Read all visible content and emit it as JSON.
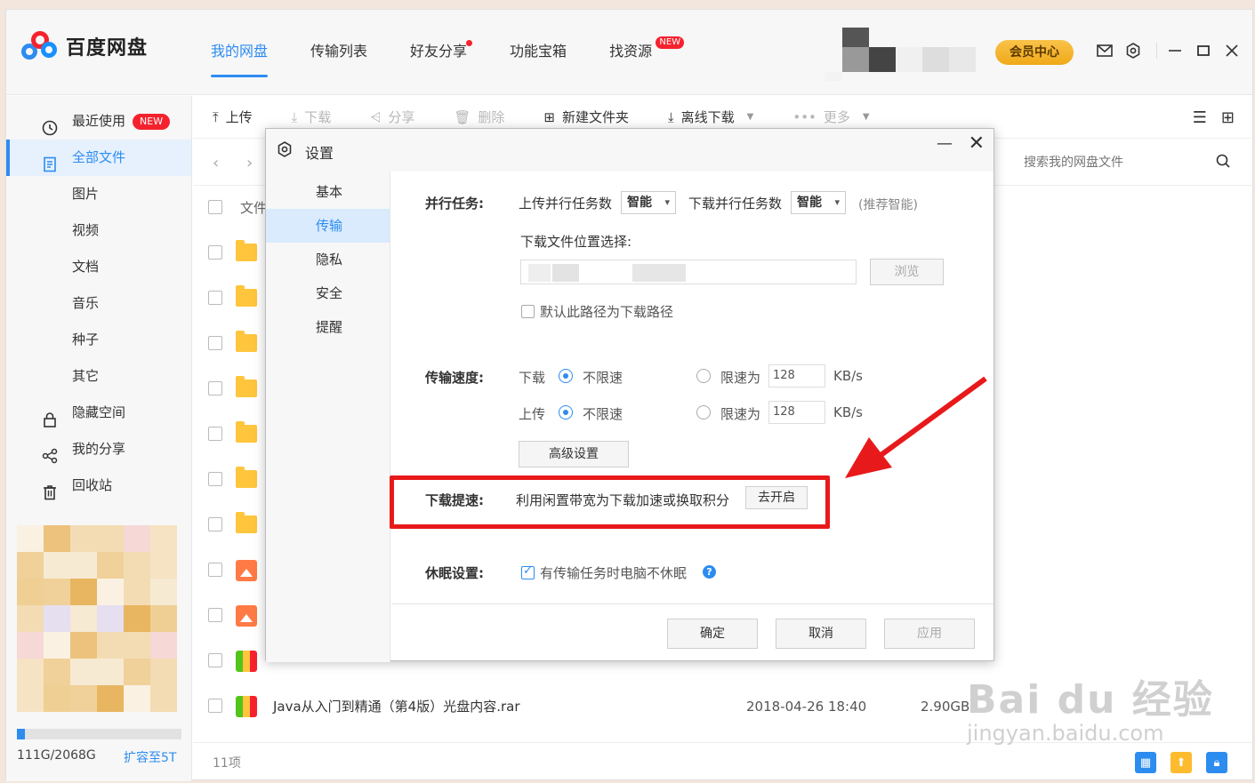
{
  "app": {
    "name": "百度网盘",
    "nav": [
      {
        "label": "我的网盘",
        "active": true
      },
      {
        "label": "传输列表"
      },
      {
        "label": "好友分享",
        "dot": true
      },
      {
        "label": "功能宝箱"
      },
      {
        "label": "找资源",
        "badge": "NEW"
      }
    ],
    "vip_label": "会员中心",
    "header_icons": [
      "mail-icon",
      "settings-icon",
      "minimize-icon",
      "maximize-icon",
      "close-icon"
    ]
  },
  "sidebar": {
    "items": [
      {
        "label": "最近使用",
        "icon": "clock-icon",
        "badge": "NEW"
      },
      {
        "label": "全部文件",
        "icon": "file-icon",
        "active": true
      },
      {
        "label": "图片"
      },
      {
        "label": "视频"
      },
      {
        "label": "文档"
      },
      {
        "label": "音乐"
      },
      {
        "label": "种子"
      },
      {
        "label": "其它"
      },
      {
        "label": "隐藏空间",
        "icon": "lock-icon"
      },
      {
        "label": "我的分享",
        "icon": "share-icon"
      },
      {
        "label": "回收站",
        "icon": "trash-icon"
      }
    ],
    "storage_text": "111G/2068G",
    "storage_percent": 5,
    "expand_label": "扩容至5T"
  },
  "toolbar": {
    "buttons": [
      {
        "label": "上传",
        "icon": "upload-icon"
      },
      {
        "label": "下载",
        "icon": "download-icon",
        "disabled": true
      },
      {
        "label": "分享",
        "icon": "share-icon",
        "disabled": true
      },
      {
        "label": "删除",
        "icon": "trash-icon",
        "disabled": true
      },
      {
        "label": "新建文件夹",
        "icon": "new-folder-icon"
      },
      {
        "label": "离线下载",
        "icon": "offline-download-icon",
        "dropdown": true
      },
      {
        "label": "更多",
        "icon": "more-icon",
        "disabled": true,
        "dropdown": true
      }
    ]
  },
  "search": {
    "placeholder": "搜索我的网盘文件"
  },
  "list": {
    "header_name": "文件",
    "rows": [
      {
        "type": "folder"
      },
      {
        "type": "folder"
      },
      {
        "type": "folder"
      },
      {
        "type": "folder"
      },
      {
        "type": "folder"
      },
      {
        "type": "folder"
      },
      {
        "type": "folder"
      },
      {
        "type": "image"
      },
      {
        "type": "image"
      },
      {
        "type": "rar"
      },
      {
        "type": "rar",
        "name": "Java从入门到精通（第4版）光盘内容.rar",
        "date": "2018-04-26 18:40",
        "size": "2.90GB"
      }
    ],
    "count": "11项"
  },
  "dialog": {
    "title": "设置",
    "nav": [
      {
        "label": "基本"
      },
      {
        "label": "传输",
        "active": true
      },
      {
        "label": "隐私"
      },
      {
        "label": "安全"
      },
      {
        "label": "提醒"
      }
    ],
    "parallel": {
      "label": "并行任务:",
      "upload_label": "上传并行任务数",
      "upload_value": "智能",
      "download_label": "下载并行任务数",
      "download_value": "智能",
      "hint": "(推荐智能)"
    },
    "download_location": {
      "label": "下载文件位置选择:",
      "browse": "浏览",
      "default_checkbox": "默认此路径为下载路径",
      "default_checked": false
    },
    "speed": {
      "label": "传输速度:",
      "download_label": "下载",
      "upload_label": "上传",
      "unlimited": "不限速",
      "limit_to": "限速为",
      "download_limit": "128",
      "upload_limit": "128",
      "unit": "KB/s",
      "advanced": "高级设置"
    },
    "accelerate": {
      "label": "下载提速:",
      "desc": "利用闲置带宽为下载加速或换取积分",
      "button": "去开启"
    },
    "sleep": {
      "label": "休眠设置:",
      "checkbox": "有传输任务时电脑不休眠",
      "checked": true
    },
    "buttons": {
      "ok": "确定",
      "cancel": "取消",
      "apply": "应用"
    }
  },
  "watermark": {
    "line1": "Bai du 经验",
    "line2": "jingyan.baidu.com"
  },
  "colors": {
    "accent": "#2d8cf0",
    "highlight_border": "#e8191b",
    "vip": "#f0a919"
  }
}
